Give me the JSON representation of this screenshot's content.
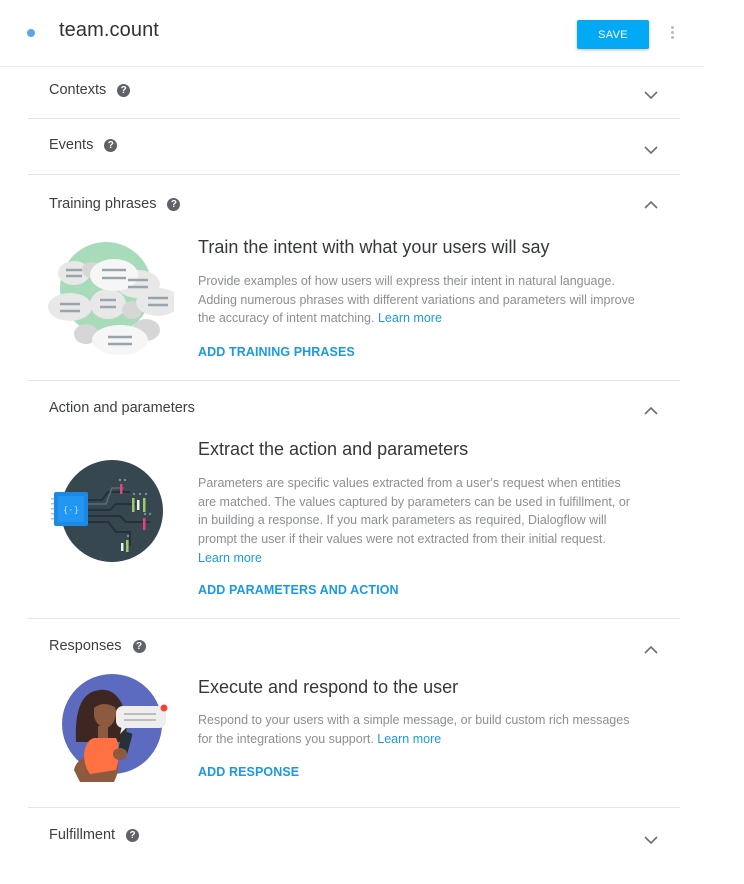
{
  "header": {
    "intent_name": "team.count",
    "save_label": "SAVE",
    "status_color": "#5aa7e6"
  },
  "sections": {
    "contexts": {
      "label": "Contexts",
      "expanded": false,
      "has_help": true
    },
    "events": {
      "label": "Events",
      "expanded": false,
      "has_help": true
    },
    "training": {
      "label": "Training phrases",
      "expanded": true,
      "has_help": true,
      "title": "Train the intent with what your users will say",
      "desc": "Provide examples of how users will express their intent in natural language. Adding numerous phrases with different variations and parameters will improve the accuracy of intent matching. ",
      "learn_more": "Learn more",
      "action": "ADD TRAINING PHRASES",
      "illustration": "chat-bubbles-illustration"
    },
    "action": {
      "label": "Action and parameters",
      "expanded": true,
      "has_help": false,
      "title": "Extract the action and parameters",
      "desc": "Parameters are specific values extracted from a user's request when entities are matched. The values captured by parameters can be used in fulfillment, or in building a response. If you mark parameters as required, Dialogflow will prompt the user if their values were not extracted from their initial request. ",
      "learn_more": "Learn more",
      "action": "ADD PARAMETERS AND ACTION",
      "illustration": "circuit-chip-illustration"
    },
    "responses": {
      "label": "Responses",
      "expanded": true,
      "has_help": true,
      "title": "Execute and respond to the user",
      "desc": "Respond to your users with a simple message, or build custom rich messages for the integrations you support. ",
      "learn_more": "Learn more",
      "action": "ADD RESPONSE",
      "illustration": "person-with-phone-illustration"
    },
    "fulfillment": {
      "label": "Fulfillment",
      "expanded": false,
      "has_help": true
    }
  },
  "colors": {
    "accent": "#03a9f4",
    "link": "#1a9ae0"
  }
}
